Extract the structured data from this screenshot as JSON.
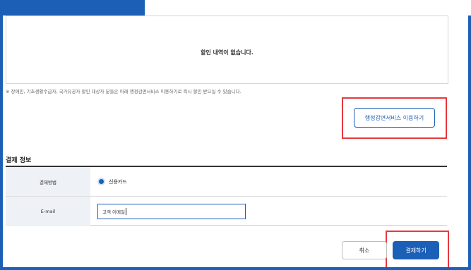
{
  "discount": {
    "empty_message": "할인 내역이 없습니다.",
    "notice": "※ 장애인, 기초생활수급자, 국가유공자 할인 대상자 분들은 아래 행정감면서비스 이용하기로 즉시 할인 받으실 수 있습니다.",
    "admin_service_button": "행정감면서비스 이용하기"
  },
  "payment": {
    "section_title": "결제 정보",
    "method_label": "결제방법",
    "method_value": "신용카드",
    "email_label": "E-mail",
    "email_value": "고객 이메일"
  },
  "actions": {
    "cancel": "취소",
    "pay": "결제하기"
  },
  "colors": {
    "accent": "#1b5fb7",
    "highlight": "#e8383d"
  }
}
